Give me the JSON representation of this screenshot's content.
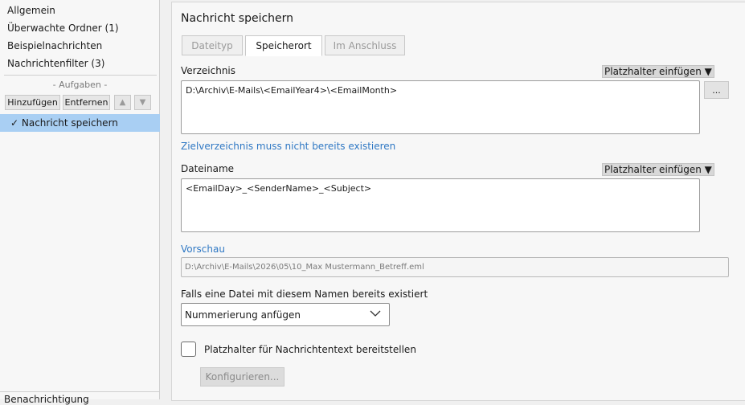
{
  "sidebar": {
    "items": [
      {
        "label": "Allgemein"
      },
      {
        "label": "Überwachte Ordner (1)"
      },
      {
        "label": "Beispielnachrichten"
      },
      {
        "label": "Nachrichtenfilter (3)"
      }
    ],
    "tasks_header": "- Aufgaben -",
    "add_button": "Hinzufügen",
    "remove_button": "Entfernen",
    "up_icon": "▲",
    "down_icon": "▼",
    "selected_task": "✓ Nachricht speichern",
    "bottom_label": "Benachrichtigung"
  },
  "main": {
    "title": "Nachricht speichern",
    "tabs": [
      {
        "label": "Dateityp"
      },
      {
        "label": "Speicherort"
      },
      {
        "label": "Im Anschluss"
      }
    ],
    "directory": {
      "label": "Verzeichnis",
      "placeholder_button": "Platzhalter einfügen ▼",
      "value": "D:\\Archiv\\E-Mails\\<EmailYear4>\\<EmailMonth>",
      "browse_button": "...",
      "hint_link": "Zielverzeichnis muss nicht bereits existieren"
    },
    "filename": {
      "label": "Dateiname",
      "placeholder_button": "Platzhalter einfügen ▼",
      "value": "<EmailDay>_<SenderName>_<Subject>"
    },
    "preview": {
      "label": "Vorschau",
      "value": "D:\\Archiv\\E-Mails\\2026\\05\\10_Max Mustermann_Betreff.eml"
    },
    "exists": {
      "label": "Falls eine Datei mit diesem Namen bereits existiert",
      "selected": "Nummerierung anfügen"
    },
    "provide_placeholder": {
      "label": "Platzhalter für Nachrichtentext bereitstellen",
      "checked": false
    },
    "configure_button": "Konfigurieren..."
  },
  "colors": {
    "selected_bg": "#a9cff3",
    "link": "#2f78c4",
    "panel_bg": "#f7f7f7",
    "window_bg": "#f0f0f0"
  }
}
